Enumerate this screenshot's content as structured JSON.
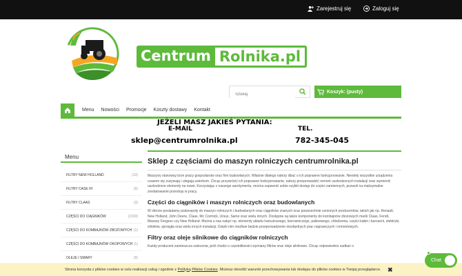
{
  "topbar": {
    "register": "Zarejestruj się",
    "login": "Zaloguj się"
  },
  "logo": {
    "part1": "Centrum",
    "part2": "Rolnika.pl"
  },
  "search": {
    "placeholder": "Szukaj"
  },
  "cart": {
    "label": "Koszyk: (pusty)"
  },
  "nav": {
    "items": [
      "Menu",
      "Nowości",
      "Promocje",
      "Koszty dostawy",
      "Kontakt"
    ]
  },
  "contact": {
    "question": "JEŻELI MASZ JAKIEŚ PYTANIA:",
    "email_label": "E-MAIL",
    "phone_label": "TEL.",
    "email": "sklep@centrumrolnika.pl",
    "phone": "782-345-045"
  },
  "sidebar": {
    "title": "Menu",
    "items": [
      {
        "label": "FILTRY NEW HOLLAND",
        "count": "(13)"
      },
      {
        "label": "FILTRY CASE IH",
        "count": "(9)"
      },
      {
        "label": "FILTRY CLAAS",
        "count": "(3)"
      },
      {
        "label": "CZĘŚCI DO CIĄGNIKÓW",
        "count": "(2103)"
      },
      {
        "label": "CZĘŚCI DO KOMBAJNÓW ZBOŻOWYCH",
        "count": "(1)"
      },
      {
        "label": "CZĘŚCI DO KOMBAJNÓW OKOPOWYCH",
        "count": "(1)"
      },
      {
        "label": "OLEJE I SMARY",
        "count": "(9)"
      }
    ]
  },
  "main": {
    "title": "Sklep z częściami do maszyn rolniczych centrumrolnika.pl",
    "p1": "Maszyny stanowią trzon pracy gospodarstw oraz firm budowlanych. Właśnie dlatego należy dbać o ich poprawne funkcjonowanie. Niestety wszystkie urządzenia czasem się zużywają i ulegają usterkom. Chcąc przywrócić ich poprawne funkcjonowanie, należy przeprowadzić remont uszkodzonych instalacji oraz wymienić uszkodzone elementy na nowe. Korzystając z naszego asortymentu, można zapewnić sobie szybki dostęp do części zamiennych, pozwoli na maksymalne zredukowanie przestoju w pracy.",
    "h2a": "Części do ciągników i maszyn rolniczych oraz budowlanych",
    "p2": "W ofercie posiadamy podzespoły do maszyn rolniczych i budowlanych oraz ciągników znanych oraz powszechnie cenionych producentów, takich jak np. Renault, New Holland, John Deere, Claas, Mc Cormick, Ursus, Same oraz wielu innych. Dostępne są także komponenty do kombajnów zbożowych marki Claas, Fendt, Massey Fergson czy New Holland. Można u nas nabyć np. elementy układu hamulcowego, kierowniczego, paliwowego, chłodzenia, części kabin i karoserii, elektryki, silników, sprzęgła oraz wielu innych instalacji. Dzięki nim możliwe będzie przeprowadzenie niezbędnych prac naprawczych i remontowych.",
    "h2b": "Filtry oraz oleje silnikowe do ciągników rolniczych",
    "p3": "Każdy producent zamieszcza zalecenia, jeśli chodzi o częstotliwości wymiany filtrów oraz oleje silnikowe. Chcąc odpowiednio zadbać o"
  },
  "cookie": {
    "text_before": "Strona korzysta z plików cookies w celu realizacji usług i zgodnie z",
    "policy_link": "Polityką Plików Cookies",
    "text_after": ". Możesz określić warunki przechowywania lub dostępu do plików cookies w Twojej przeglądarce.",
    "close": "✖"
  },
  "chat": {
    "label": "Chat"
  },
  "colors": {
    "accent": "#5dba3b",
    "topbar": "#111111",
    "cookie_bg": "#fbf3c4"
  }
}
